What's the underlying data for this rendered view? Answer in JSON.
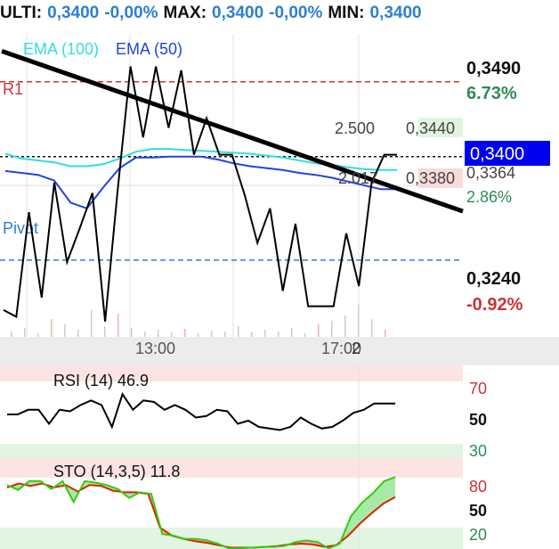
{
  "ticker": {
    "ulti_label": "ULTI:",
    "ulti_value": "0,3400",
    "ulti_change": "-0,00%",
    "max_label": "MAX:",
    "max_value": "0,3400",
    "max_change": "-0,00%",
    "min_label": "MIN:",
    "min_value": "0,3400"
  },
  "main_chart": {
    "legend": {
      "ema100": "EMA (100)",
      "ema50": "EMA (50)"
    },
    "levels": {
      "r1": "R1",
      "pivot": "Pivot"
    },
    "axis": {
      "top_price": "0,3490",
      "top_pct": "6.73%",
      "current_price": "0,3400",
      "mid_price": "0,3364",
      "mid_pct": "2.86%",
      "low_price": "0,3240",
      "low_pct": "-0.92%"
    },
    "orderbook": {
      "ask_qty": "2.500",
      "ask_price": "0,3440",
      "bid_qty": "2.017",
      "bid_price": "0,3380"
    },
    "time_labels": [
      "13:00",
      "17:00",
      "2"
    ],
    "colors": {
      "ema100": "#33dddd",
      "ema50": "#2244dd",
      "price": "#000000",
      "trendline": "#000000",
      "r1": "#cc3333",
      "pivot": "#2b7fd4",
      "green": "#2e8b57",
      "red": "#cc3333",
      "price_box": "#0000ee"
    }
  },
  "rsi_panel": {
    "title": "RSI (14) 46.9",
    "levels": [
      "70",
      "50",
      "30"
    ]
  },
  "sto_panel": {
    "title": "STO (14,3,5) 11.8",
    "levels": [
      "80",
      "50",
      "20"
    ]
  },
  "chart_data": {
    "type": "line",
    "x_ticks": [
      "13:00",
      "17:00"
    ],
    "y_ticks": [
      "0,3490",
      "0,3364",
      "0,3240"
    ],
    "y_pct_ticks": [
      "6.73%",
      "2.86%",
      "-0.92%"
    ],
    "ylim": [
      0.3212,
      0.3528
    ],
    "reference_lines": {
      "R1": 0.3478,
      "Pivot": 0.3292,
      "last": 0.34
    },
    "series": [
      {
        "name": "EMA (100)",
        "values": [
          0.3403,
          0.3398,
          0.3396,
          0.3394,
          0.339,
          0.339,
          0.3392,
          0.3398,
          0.3405,
          0.3408,
          0.3408,
          0.3407,
          0.3406,
          0.3405,
          0.3404,
          0.3403,
          0.3401,
          0.3399,
          0.3396,
          0.3393,
          0.3391,
          0.3389,
          0.3387,
          0.3386,
          0.3386
        ]
      },
      {
        "name": "EMA (50)",
        "values": [
          0.3385,
          0.3383,
          0.3381,
          0.3375,
          0.3352,
          0.3346,
          0.3368,
          0.3388,
          0.3399,
          0.3399,
          0.34,
          0.34,
          0.34,
          0.3397,
          0.3393,
          0.339,
          0.3388,
          0.3386,
          0.3383,
          0.3381,
          0.3378,
          0.3374,
          0.337,
          0.3366,
          0.3366
        ]
      },
      {
        "name": "Price",
        "values": [
          0.324,
          0.3233,
          0.3342,
          0.3253,
          0.3373,
          0.329,
          0.3325,
          0.3362,
          0.3228,
          0.3366,
          0.3494,
          0.342,
          0.3494,
          0.343,
          0.349,
          0.3402,
          0.344,
          0.3402,
          0.3402,
          0.336,
          0.331,
          0.3346,
          0.326,
          0.333,
          0.3244,
          0.3244,
          0.3244,
          0.332,
          0.3265,
          0.3373,
          0.3402,
          0.3402
        ]
      }
    ],
    "trendline": {
      "from": 0.351,
      "to": 0.3343
    },
    "rsi": {
      "name": "RSI (14)",
      "last": 46.9,
      "levels": [
        70,
        50,
        30
      ],
      "values": [
        54,
        54,
        57,
        57,
        48,
        57,
        56,
        60,
        63,
        60,
        46,
        67,
        57,
        63,
        62,
        57,
        60,
        57,
        52,
        53,
        57,
        56,
        48,
        50,
        46,
        45,
        44,
        46,
        52,
        48,
        45,
        46,
        50,
        55,
        57,
        61,
        61,
        61
      ]
    },
    "sto": {
      "name": "STO (14,3,5)",
      "last": 11.8,
      "levels": [
        80,
        50,
        20
      ],
      "k": [
        83,
        77,
        88,
        88,
        78,
        88,
        62,
        88,
        86,
        83,
        78,
        67,
        74,
        72,
        22,
        20,
        16,
        16,
        14,
        10,
        4,
        4,
        5,
        6,
        6,
        7,
        12,
        14,
        12,
        4,
        10,
        44,
        61,
        73,
        88,
        93
      ],
      "d": [
        80,
        85,
        82,
        85,
        80,
        83,
        75,
        83,
        82,
        76,
        74,
        74,
        72,
        30,
        20,
        16,
        13,
        11,
        8,
        5,
        5,
        5,
        6,
        7,
        9,
        10,
        9,
        6,
        8,
        20,
        35,
        48,
        60,
        68
      ]
    }
  }
}
